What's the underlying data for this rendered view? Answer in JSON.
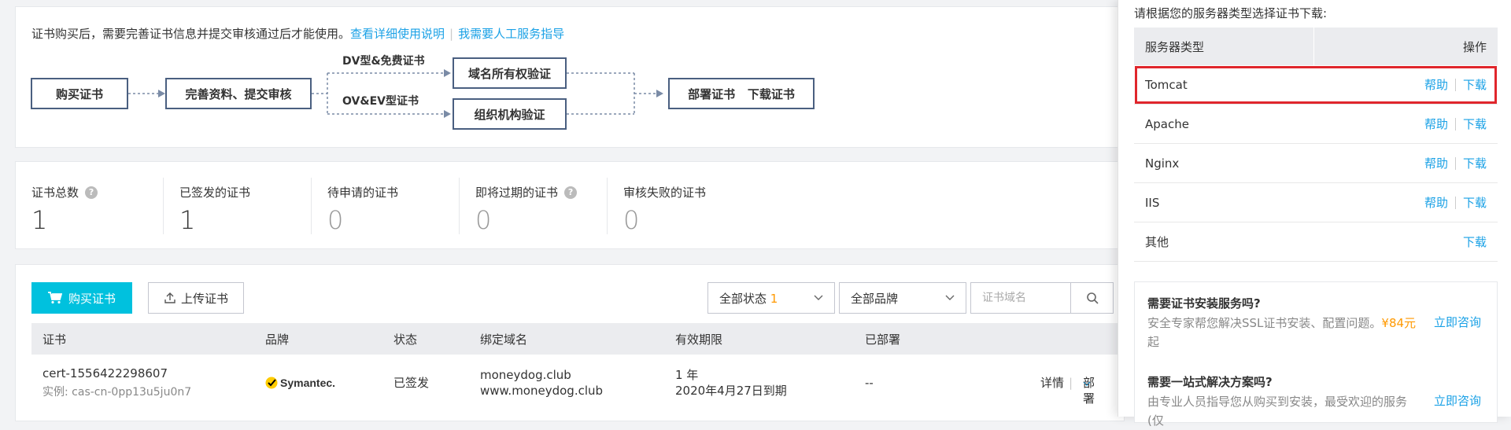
{
  "intro": {
    "text": "证书购买后，需要完善证书信息并提交审核通过后才能使用。",
    "link1": "查看详细使用说明",
    "link2": "我需要人工服务指导"
  },
  "flow": {
    "step1": "购买证书",
    "step2": "完善资料、提交审核",
    "branch1_label": "DV型&免费证书",
    "branch2_label": "OV&EV型证书",
    "verify1": "域名所有权验证",
    "verify2": "组织机构验证",
    "final": "部署证书   下载证书"
  },
  "stats": [
    {
      "label": "证书总数",
      "value": "1",
      "help": true
    },
    {
      "label": "已签发的证书",
      "value": "1",
      "help": false
    },
    {
      "label": "待申请的证书",
      "value": "0",
      "help": false
    },
    {
      "label": "即将过期的证书",
      "value": "0",
      "help": true
    },
    {
      "label": "审核失败的证书",
      "value": "0",
      "help": false
    }
  ],
  "toolbar": {
    "buy_label": "购买证书",
    "upload_label": "上传证书",
    "status_select": "全部状态",
    "status_count": "1",
    "brand_select": "全部品牌",
    "search_placeholder": "证书域名"
  },
  "table": {
    "headers": [
      "证书",
      "品牌",
      "状态",
      "绑定域名",
      "有效期限",
      "已部署"
    ],
    "rows": [
      {
        "cert_name": "cert-1556422298607",
        "instance": "实例: cas-cn-0pp13u5ju0n7",
        "brand": "Symantec.",
        "status": "已签发",
        "domain1": "moneydog.club",
        "domain2": "www.moneydog.club",
        "validity1": "1 年",
        "validity2": "2020年4月27日到期",
        "deployed": "--",
        "action_detail": "详情",
        "action_deploy": "部署"
      }
    ]
  },
  "drawer": {
    "title": "请根据您的服务器类型选择证书下载:",
    "col_server": "服务器类型",
    "col_action": "操作",
    "help_label": "帮助",
    "download_label": "下载",
    "servers": [
      {
        "name": "Tomcat",
        "help": true,
        "highlight": true
      },
      {
        "name": "Apache",
        "help": true,
        "highlight": false
      },
      {
        "name": "Nginx",
        "help": true,
        "highlight": false
      },
      {
        "name": "IIS",
        "help": true,
        "highlight": false
      },
      {
        "name": "其他",
        "help": false,
        "highlight": false
      }
    ],
    "promo1_title": "需要证书安装服务吗?",
    "promo1_desc_a": "安全专家帮您解决SSL证书安装、配置问题。",
    "promo1_price": "¥84元",
    "promo1_desc_b": "起",
    "promo1_cta": "立即咨询",
    "promo2_title": "需要一站式解决方案吗?",
    "promo2_desc": "由专业人员指导您从购买到安装，最受欢迎的服务(仅",
    "promo2_cta": "立即咨询"
  },
  "colors": {
    "accent": "#00c1de",
    "link": "#1aa1e6",
    "highlight": "#e0262c",
    "price": "#ff9900"
  }
}
